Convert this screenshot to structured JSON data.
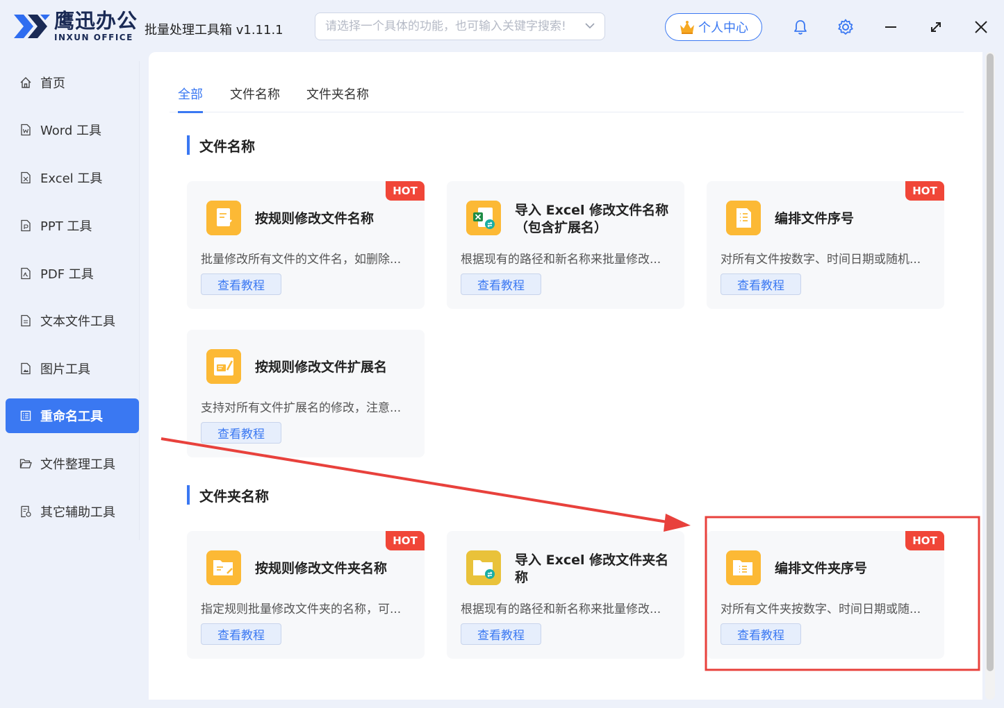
{
  "app": {
    "brand_cn": "鹰迅办公",
    "brand_en": "INXUN OFFICE",
    "title": "批量处理工具箱 v1.11.1"
  },
  "search": {
    "placeholder": "请选择一个具体的功能，也可输入关键字搜索!"
  },
  "header": {
    "user_center": "个人中心"
  },
  "sidebar": {
    "items": [
      {
        "label": "首页",
        "icon": "home-icon"
      },
      {
        "label": "Word 工具",
        "icon": "word-file-icon"
      },
      {
        "label": "Excel 工具",
        "icon": "excel-file-icon"
      },
      {
        "label": "PPT 工具",
        "icon": "ppt-file-icon"
      },
      {
        "label": "PDF 工具",
        "icon": "pdf-file-icon"
      },
      {
        "label": "文本文件工具",
        "icon": "text-file-icon"
      },
      {
        "label": "图片工具",
        "icon": "image-file-icon"
      },
      {
        "label": "重命名工具",
        "icon": "rename-list-icon",
        "active": true
      },
      {
        "label": "文件整理工具",
        "icon": "folder-open-icon"
      },
      {
        "label": "其它辅助工具",
        "icon": "tools-file-icon"
      }
    ]
  },
  "tabs": [
    {
      "label": "全部",
      "active": true
    },
    {
      "label": "文件名称"
    },
    {
      "label": "文件夹名称"
    }
  ],
  "sections": [
    {
      "title": "文件名称",
      "cards": [
        {
          "title": "按规则修改文件名称",
          "desc": "批量修改所有文件的文件名，如删除...",
          "button": "查看教程",
          "hot": "HOT",
          "icon": "document-edit-icon"
        },
        {
          "title": "导入 Excel 修改文件名称（包含扩展名）",
          "desc": "根据现有的路径和新名称来批量修改...",
          "button": "查看教程",
          "icon": "excel-import-icon"
        },
        {
          "title": "编排文件序号",
          "desc": "对所有文件按数字、时间日期或随机...",
          "button": "查看教程",
          "hot": "HOT",
          "icon": "numbered-list-icon"
        },
        {
          "title": "按规则修改文件扩展名",
          "desc": "支持对所有文件扩展名的修改，注意...",
          "button": "查看教程",
          "icon": "extension-edit-icon"
        }
      ]
    },
    {
      "title": "文件夹名称",
      "cards": [
        {
          "title": "按规则修改文件夹名称",
          "desc": "指定规则批量修改文件夹的名称，可...",
          "button": "查看教程",
          "hot": "HOT",
          "icon": "folder-edit-icon"
        },
        {
          "title": "导入 Excel 修改文件夹名称",
          "desc": "根据现有的路径和新名称来批量修改...",
          "button": "查看教程",
          "icon": "folder-sync-icon"
        },
        {
          "title": "编排文件夹序号",
          "desc": "对所有文件夹按数字、时间日期或随...",
          "button": "查看教程",
          "hot": "HOT",
          "icon": "folder-list-icon"
        }
      ]
    }
  ],
  "colors": {
    "accent": "#3a78f2",
    "hot": "#f04638",
    "icon_bg": "#fcb935",
    "annotation": "#e8413c"
  }
}
